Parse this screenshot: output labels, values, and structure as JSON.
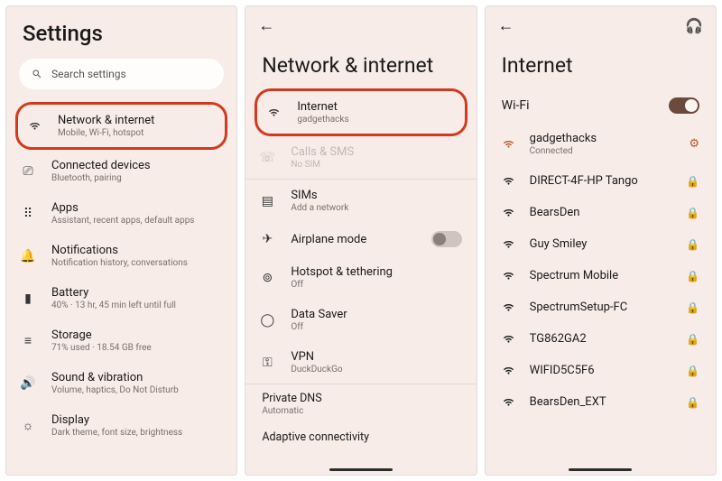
{
  "screen1": {
    "title": "Settings",
    "search_placeholder": "Search settings",
    "items": [
      {
        "title": "Network & internet",
        "sub": "Mobile, Wi-Fi, hotspot"
      },
      {
        "title": "Connected devices",
        "sub": "Bluetooth, pairing"
      },
      {
        "title": "Apps",
        "sub": "Assistant, recent apps, default apps"
      },
      {
        "title": "Notifications",
        "sub": "Notification history, conversations"
      },
      {
        "title": "Battery",
        "sub": "40% · 13 hr, 45 min left until full"
      },
      {
        "title": "Storage",
        "sub": "71% used · 18.54 GB free"
      },
      {
        "title": "Sound & vibration",
        "sub": "Volume, haptics, Do Not Disturb"
      },
      {
        "title": "Display",
        "sub": "Dark theme, font size, brightness"
      }
    ]
  },
  "screen2": {
    "title": "Network & internet",
    "items": [
      {
        "title": "Internet",
        "sub": "gadgethacks"
      },
      {
        "title": "Calls & SMS",
        "sub": "No SIM"
      },
      {
        "title": "SIMs",
        "sub": "Add a network"
      },
      {
        "title": "Airplane mode",
        "toggle": "off"
      },
      {
        "title": "Hotspot & tethering",
        "sub": "Off"
      },
      {
        "title": "Data Saver",
        "sub": "Off"
      },
      {
        "title": "VPN",
        "sub": "DuckDuckGo"
      }
    ],
    "private_dns": {
      "title": "Private DNS",
      "sub": "Automatic"
    },
    "adaptive": "Adaptive connectivity"
  },
  "screen3": {
    "title": "Internet",
    "wifi_label": "Wi-Fi",
    "wifi_toggle": "on",
    "connected": {
      "name": "gadgethacks",
      "status": "Connected"
    },
    "networks": [
      {
        "name": "DIRECT-4F-HP Tango"
      },
      {
        "name": "BearsDen"
      },
      {
        "name": "Guy Smiley"
      },
      {
        "name": "Spectrum Mobile"
      },
      {
        "name": "SpectrumSetup-FC"
      },
      {
        "name": "TG862GA2"
      },
      {
        "name": "WIFID5C5F6"
      },
      {
        "name": "BearsDen_EXT"
      }
    ]
  }
}
